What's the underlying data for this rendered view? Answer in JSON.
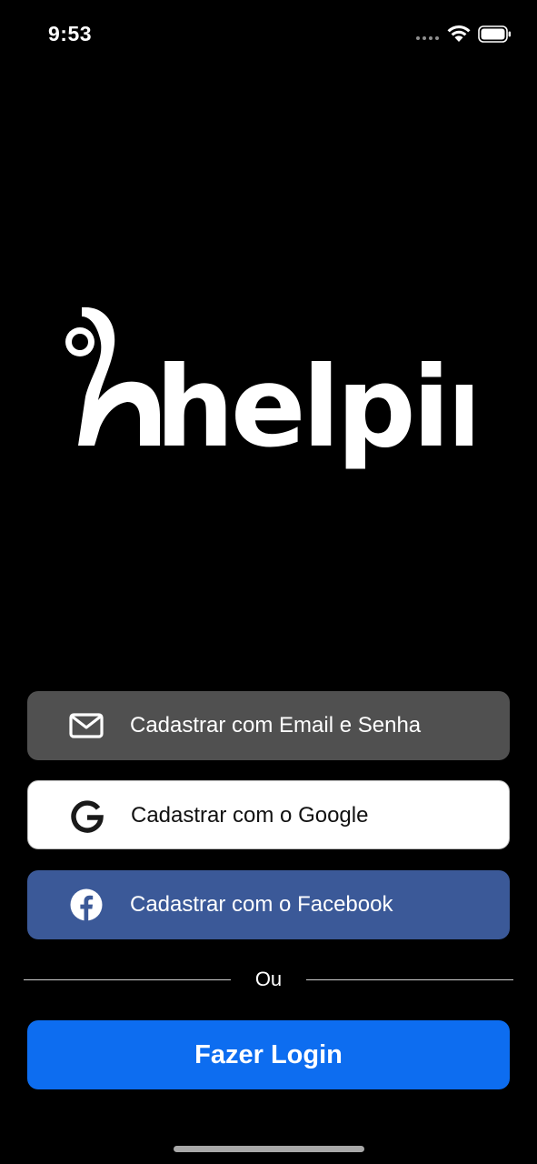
{
  "status_bar": {
    "time": "9:53"
  },
  "logo": {
    "text": "helpin",
    "color": "#ffffff"
  },
  "signup_options": [
    {
      "label": "Cadastrar com Email e Senha",
      "icon": "mail-icon",
      "background": "#505050"
    },
    {
      "label": "Cadastrar com o Google",
      "icon": "google-icon",
      "background": "#ffffff"
    },
    {
      "label": "Cadastrar com o Facebook",
      "icon": "facebook-icon",
      "background": "#3b5998"
    }
  ],
  "divider": {
    "text": "Ou"
  },
  "login": {
    "label": "Fazer Login",
    "background": "#0d6df0"
  }
}
